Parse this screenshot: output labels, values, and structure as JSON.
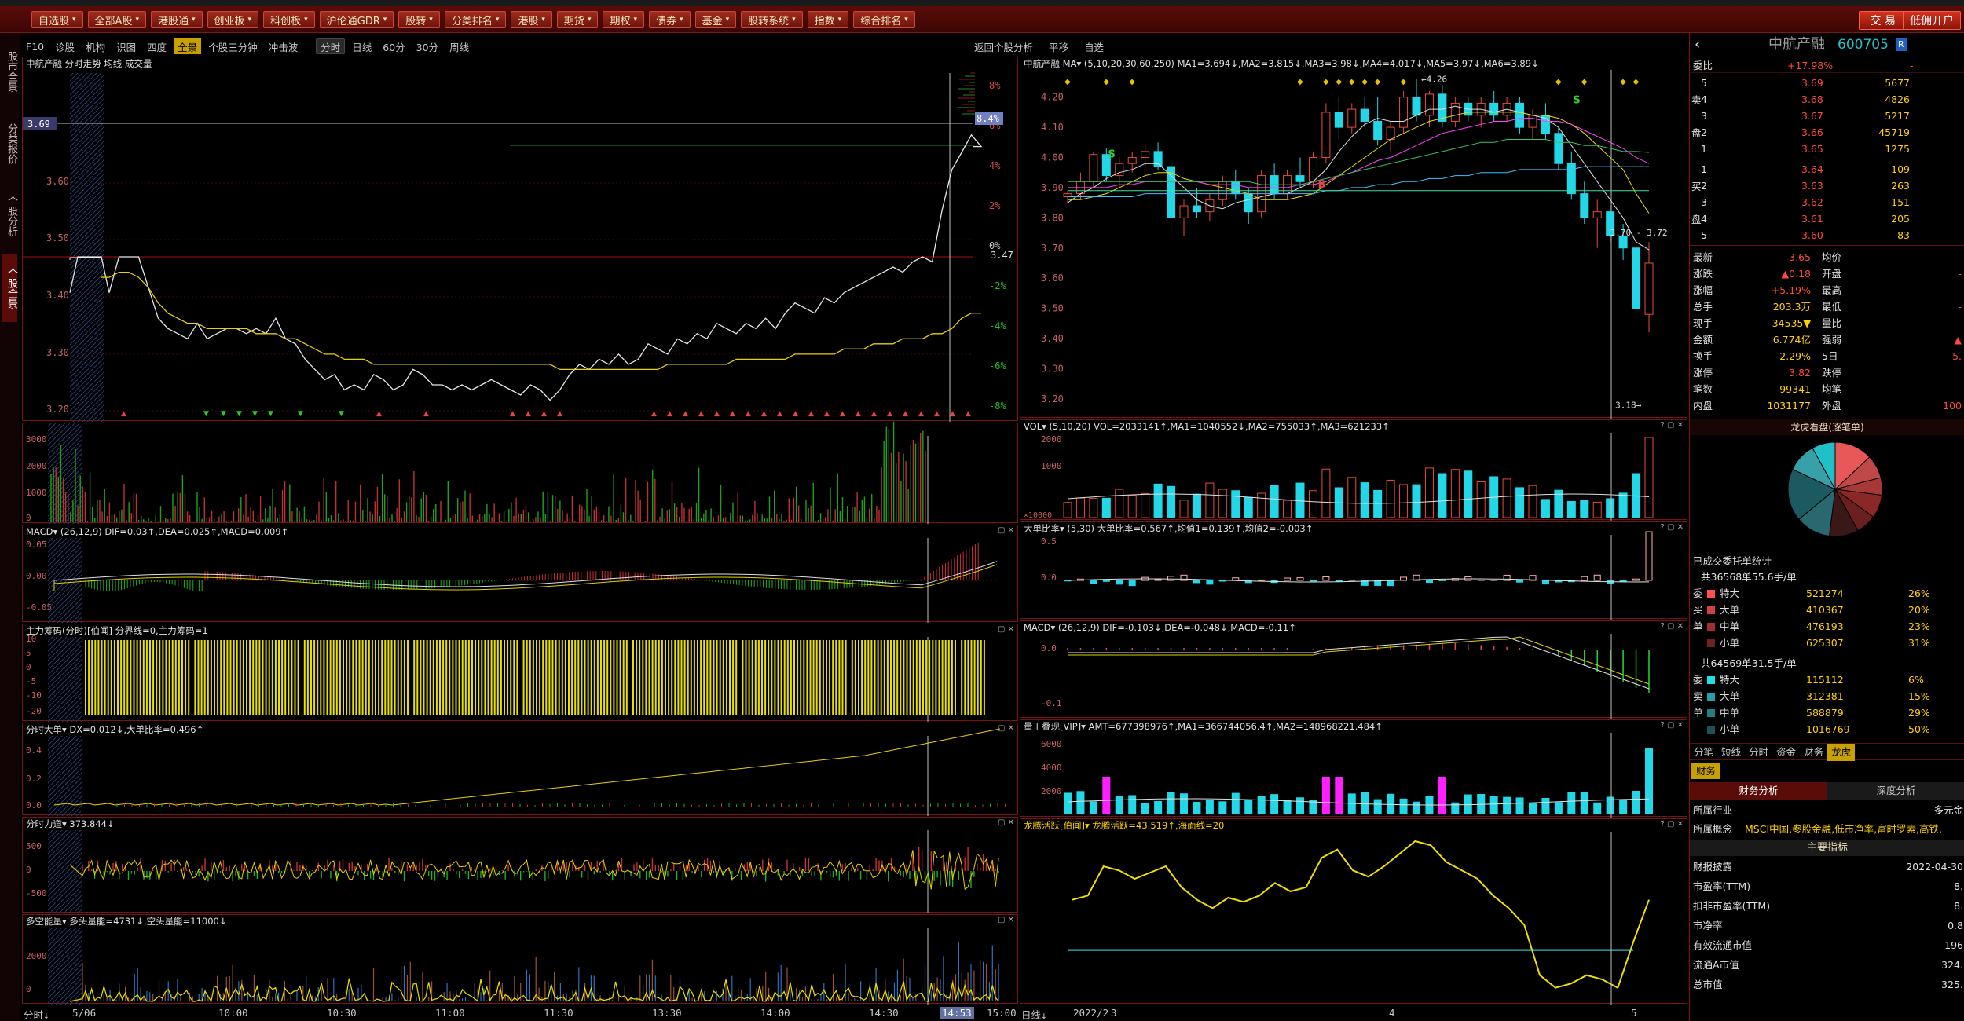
{
  "toolbar": {
    "buttons": [
      "自选股",
      "全部A股",
      "港股通",
      "创业板",
      "科创板",
      "沪伦通GDR",
      "股转",
      "分类排名",
      "港股",
      "期货",
      "期权",
      "债券",
      "基金",
      "股转系统",
      "指数",
      "综合排名"
    ],
    "trade": "交 易",
    "open_account": "低佣开户",
    "more": "期货"
  },
  "left_tabs": [
    "股市全景",
    "分类报价",
    "个股分析",
    "个股全景"
  ],
  "subtabs": {
    "items": [
      "F10",
      "诊股",
      "机构",
      "识图",
      "四度",
      "全景",
      "个股三分钟",
      "冲击波"
    ],
    "active": "全景",
    "period_items": [
      "分时",
      "日线",
      "60分",
      "30分",
      "周线"
    ],
    "right_items": [
      "返回个股分析",
      "平移",
      "自选"
    ]
  },
  "intraday": {
    "header": "中航产融  分时走势  均线  成交量",
    "hline_label": "3.69",
    "prices": [
      "3.60",
      "3.50",
      "3.40",
      "3.30",
      "3.20"
    ],
    "pcts": [
      "8%",
      "6%",
      "4%",
      "2%",
      "0%",
      "-2%",
      "-4%",
      "-6%",
      "-8%"
    ],
    "pct_badge": "8.4%",
    "mid_label": "3.47",
    "trend": [
      3.4,
      3.47,
      3.47,
      3.47,
      3.41,
      3.35,
      3.33,
      3.32,
      3.31,
      3.34,
      3.31,
      3.32,
      3.33,
      3.33,
      3.32,
      3.33,
      3.32,
      3.35,
      3.31,
      3.3,
      3.27,
      3.25,
      3.23,
      3.24,
      3.21,
      3.22,
      3.21,
      3.24,
      3.23,
      3.21,
      3.22,
      3.25,
      3.24,
      3.22,
      3.22,
      3.21,
      3.22,
      3.21,
      3.22,
      3.23,
      3.22,
      3.21,
      3.2,
      3.22,
      3.21,
      3.19,
      3.21,
      3.24,
      3.26,
      3.25,
      3.27,
      3.26,
      3.28,
      3.26,
      3.27,
      3.3,
      3.29,
      3.28,
      3.31,
      3.3,
      3.32,
      3.31,
      3.34,
      3.33,
      3.32,
      3.34,
      3.33,
      3.35,
      3.33,
      3.36,
      3.38,
      3.37,
      3.36,
      3.39,
      3.38,
      3.4,
      3.41,
      3.42,
      3.43,
      3.44,
      3.45,
      3.44,
      3.46,
      3.47,
      3.46,
      3.55,
      3.62,
      3.65,
      3.68,
      3.66
    ],
    "avg": [
      3.43,
      3.44,
      3.44,
      3.43,
      3.41,
      3.38,
      3.36,
      3.35,
      3.34,
      3.34,
      3.33,
      3.33,
      3.33,
      3.33,
      3.33,
      3.32,
      3.32,
      3.32,
      3.31,
      3.31,
      3.3,
      3.29,
      3.28,
      3.28,
      3.27,
      3.27,
      3.27,
      3.26,
      3.26,
      3.26,
      3.26,
      3.26,
      3.26,
      3.26,
      3.26,
      3.26,
      3.26,
      3.26,
      3.26,
      3.26,
      3.26,
      3.26,
      3.26,
      3.26,
      3.26,
      3.26,
      3.25,
      3.25,
      3.25,
      3.25,
      3.25,
      3.25,
      3.25,
      3.25,
      3.25,
      3.25,
      3.25,
      3.26,
      3.26,
      3.26,
      3.26,
      3.26,
      3.26,
      3.26,
      3.27,
      3.27,
      3.27,
      3.27,
      3.27,
      3.27,
      3.28,
      3.28,
      3.28,
      3.28,
      3.28,
      3.29,
      3.29,
      3.29,
      3.3,
      3.3,
      3.3,
      3.31,
      3.31,
      3.31,
      3.32,
      3.32,
      3.33,
      3.35,
      3.36,
      3.36
    ]
  },
  "vol_panel": {
    "labels": [
      "3000",
      "2000",
      "1000",
      "0"
    ]
  },
  "macd_left": {
    "header": "MACD▾  (26,12,9)  DIF=0.03↑,DEA=0.025↑,MACD=0.009↑",
    "labels": [
      "0.05",
      "0.00",
      "-0.05"
    ]
  },
  "zhuli": {
    "header": "主力筹码(分时)[伯闻]  分界线=0,主力筹码=1",
    "labels": [
      "10",
      "5",
      "0",
      "-5",
      "-10",
      "-20"
    ]
  },
  "fenshi_dadan": {
    "header": "分时大单▾  DX=0.012↓,大单比率=0.496↑",
    "labels": [
      "0.4",
      "0.2",
      "0.0"
    ]
  },
  "fenshi_lidao": {
    "header": "分时力道▾  373.844↓",
    "labels": [
      "500",
      "0",
      "-500"
    ]
  },
  "duokong": {
    "header": "多空能量▾  多头量能=4731↓,空头量能=11000↓",
    "labels": [
      "2000",
      "0"
    ]
  },
  "timeaxis": {
    "left": "分时↓",
    "date": "5/06",
    "ticks": [
      "10:00",
      "10:30",
      "11:00",
      "11:30",
      "13:30",
      "14:00",
      "14:30",
      "14:53",
      "15:00"
    ]
  },
  "daily": {
    "header": "中航产融  MA▾  (5,10,20,30,60,250)  MA1=3.694↓,MA2=3.815↓,MA3=3.98↓,MA4=4.017↓,MA5=3.97↓,MA6=3.89↓",
    "prices": [
      "4.20",
      "4.10",
      "4.00",
      "3.90",
      "3.80",
      "3.70",
      "3.60",
      "3.50",
      "3.40",
      "3.30",
      "3.20"
    ],
    "hi_label": "4.26",
    "lo_label": "3.18",
    "range_label": "3.70 - 3.72",
    "ohlc": [
      [
        3.87,
        3.89,
        3.85,
        3.88
      ],
      [
        3.88,
        3.95,
        3.86,
        3.92
      ],
      [
        3.92,
        4.02,
        3.9,
        4.01
      ],
      [
        4.01,
        4.03,
        3.92,
        3.94
      ],
      [
        3.94,
        4.0,
        3.9,
        3.98
      ],
      [
        3.98,
        4.02,
        3.95,
        4.0
      ],
      [
        4.0,
        4.04,
        3.97,
        4.02
      ],
      [
        4.02,
        4.05,
        3.96,
        3.97
      ],
      [
        3.97,
        3.99,
        3.75,
        3.8
      ],
      [
        3.8,
        3.86,
        3.74,
        3.84
      ],
      [
        3.84,
        3.9,
        3.8,
        3.82
      ],
      [
        3.82,
        3.88,
        3.79,
        3.86
      ],
      [
        3.86,
        3.94,
        3.84,
        3.92
      ],
      [
        3.92,
        3.96,
        3.86,
        3.88
      ],
      [
        3.88,
        3.9,
        3.78,
        3.82
      ],
      [
        3.82,
        3.96,
        3.8,
        3.94
      ],
      [
        3.94,
        3.98,
        3.86,
        3.88
      ],
      [
        3.88,
        3.96,
        3.86,
        3.94
      ],
      [
        3.94,
        4.0,
        3.9,
        3.92
      ],
      [
        3.92,
        4.02,
        3.9,
        4.0
      ],
      [
        4.0,
        4.18,
        3.98,
        4.15
      ],
      [
        4.15,
        4.2,
        4.06,
        4.1
      ],
      [
        4.1,
        4.18,
        4.08,
        4.16
      ],
      [
        4.16,
        4.2,
        4.1,
        4.12
      ],
      [
        4.12,
        4.2,
        4.04,
        4.06
      ],
      [
        4.06,
        4.12,
        4.02,
        4.1
      ],
      [
        4.1,
        4.22,
        4.08,
        4.2
      ],
      [
        4.2,
        4.26,
        4.12,
        4.14
      ],
      [
        4.14,
        4.22,
        4.1,
        4.21
      ],
      [
        4.21,
        4.24,
        4.1,
        4.12
      ],
      [
        4.12,
        4.2,
        4.1,
        4.18
      ],
      [
        4.18,
        4.2,
        4.12,
        4.14
      ],
      [
        4.14,
        4.2,
        4.1,
        4.18
      ],
      [
        4.18,
        4.22,
        4.12,
        4.14
      ],
      [
        4.14,
        4.2,
        4.12,
        4.18
      ],
      [
        4.18,
        4.2,
        4.08,
        4.1
      ],
      [
        4.1,
        4.16,
        4.06,
        4.14
      ],
      [
        4.14,
        4.18,
        4.06,
        4.08
      ],
      [
        4.08,
        4.1,
        3.96,
        3.98
      ],
      [
        3.98,
        4.02,
        3.86,
        3.88
      ],
      [
        3.88,
        3.92,
        3.78,
        3.8
      ],
      [
        3.8,
        3.86,
        3.7,
        3.82
      ],
      [
        3.82,
        3.84,
        3.72,
        3.74
      ],
      [
        3.74,
        3.78,
        3.66,
        3.7
      ],
      [
        3.7,
        3.72,
        3.48,
        3.5
      ],
      [
        3.48,
        3.72,
        3.42,
        3.65
      ]
    ],
    "ma_lines": [
      {
        "color": "#e0e0e0",
        "values": [
          3.85,
          3.88,
          3.9,
          3.93,
          3.95,
          3.96,
          3.98,
          3.98,
          3.94,
          3.9,
          3.86,
          3.84,
          3.83,
          3.85,
          3.86,
          3.87,
          3.88,
          3.88,
          3.9,
          3.92,
          3.96,
          4.02,
          4.07,
          4.11,
          4.13,
          4.12,
          4.12,
          4.14,
          4.16,
          4.16,
          4.17,
          4.16,
          4.16,
          4.15,
          4.16,
          4.15,
          4.14,
          4.13,
          4.1,
          4.04,
          3.98,
          3.92,
          3.86,
          3.8,
          3.72,
          3.694
        ]
      },
      {
        "color": "#e8e000",
        "values": [
          3.86,
          3.86,
          3.87,
          3.88,
          3.9,
          3.92,
          3.94,
          3.95,
          3.95,
          3.93,
          3.92,
          3.91,
          3.9,
          3.89,
          3.88,
          3.86,
          3.86,
          3.86,
          3.87,
          3.88,
          3.91,
          3.94,
          3.97,
          4.0,
          4.03,
          4.06,
          4.08,
          4.1,
          4.12,
          4.13,
          4.14,
          4.15,
          4.15,
          4.15,
          4.15,
          4.15,
          4.14,
          4.14,
          4.13,
          4.11,
          4.08,
          4.04,
          4.0,
          3.96,
          3.88,
          3.815
        ]
      },
      {
        "color": "#ff40ff",
        "values": [
          3.9,
          3.9,
          3.9,
          3.9,
          3.91,
          3.91,
          3.92,
          3.92,
          3.92,
          3.92,
          3.92,
          3.91,
          3.91,
          3.91,
          3.9,
          3.9,
          3.9,
          3.9,
          3.91,
          3.91,
          3.92,
          3.94,
          3.95,
          3.97,
          3.99,
          4.0,
          4.02,
          4.04,
          4.06,
          4.08,
          4.09,
          4.1,
          4.11,
          4.12,
          4.12,
          4.13,
          4.13,
          4.12,
          4.12,
          4.11,
          4.09,
          4.07,
          4.05,
          4.03,
          4.0,
          3.98
        ]
      },
      {
        "color": "#3cc060",
        "values": [
          3.92,
          3.92,
          3.92,
          3.92,
          3.92,
          3.92,
          3.92,
          3.92,
          3.92,
          3.92,
          3.92,
          3.92,
          3.92,
          3.92,
          3.92,
          3.91,
          3.91,
          3.91,
          3.91,
          3.92,
          3.93,
          3.94,
          3.95,
          3.96,
          3.97,
          3.98,
          3.99,
          4.0,
          4.01,
          4.02,
          4.03,
          4.04,
          4.05,
          4.05,
          4.06,
          4.06,
          4.06,
          4.06,
          4.05,
          4.05,
          4.04,
          4.04,
          4.03,
          4.02,
          4.02,
          4.017
        ]
      },
      {
        "color": "#40c0ff",
        "values": [
          3.87,
          3.87,
          3.87,
          3.87,
          3.87,
          3.87,
          3.88,
          3.88,
          3.88,
          3.88,
          3.88,
          3.88,
          3.88,
          3.88,
          3.88,
          3.88,
          3.88,
          3.88,
          3.88,
          3.88,
          3.89,
          3.89,
          3.9,
          3.9,
          3.91,
          3.91,
          3.92,
          3.92,
          3.93,
          3.93,
          3.94,
          3.94,
          3.95,
          3.95,
          3.95,
          3.96,
          3.96,
          3.96,
          3.96,
          3.96,
          3.97,
          3.97,
          3.97,
          3.97,
          3.97,
          3.97
        ]
      },
      {
        "color": "#40e0a0",
        "values": [
          3.89,
          3.89,
          3.89,
          3.89,
          3.89,
          3.89,
          3.89,
          3.89,
          3.89,
          3.89,
          3.89,
          3.89,
          3.89,
          3.89,
          3.89,
          3.89,
          3.89,
          3.89,
          3.89,
          3.89,
          3.89,
          3.89,
          3.89,
          3.89,
          3.89,
          3.89,
          3.89,
          3.89,
          3.89,
          3.89,
          3.89,
          3.89,
          3.89,
          3.89,
          3.89,
          3.89,
          3.89,
          3.89,
          3.89,
          3.89,
          3.89,
          3.89,
          3.89,
          3.89,
          3.89,
          3.89
        ]
      }
    ]
  },
  "vol_daily": {
    "header": "VOL▾  (5,10,20)  VOL=2033141↑,MA1=1040552↓,MA2=755033↑,MA3=621233↑",
    "labels": [
      "2000",
      "1000"
    ],
    "unit": "×10000"
  },
  "dadan_ratio": {
    "header": "大单比率▾  (5,30)  大单比率=0.567↑,均值1=0.139↑,均值2=-0.003↑",
    "labels": [
      "0.5",
      "0.0"
    ]
  },
  "macd_daily": {
    "header": "MACD▾  (26,12,9)  DIF=-0.103↓,DEA=-0.048↓,MACD=-0.11↑",
    "labels": [
      "0.0",
      "-0.1"
    ]
  },
  "liangwang": {
    "header": "量王叠现[VIP]▾  AMT=677398976↑,MA1=366744056.4↑,MA2=148968221.484↑",
    "labels": [
      "6000",
      "4000",
      "2000"
    ]
  },
  "longhu": {
    "header": "龙腾活跃[伯闻]▾  龙腾活跃=43.519↑,海面线=20",
    "values": [
      44,
      46,
      60,
      58,
      54,
      57,
      60,
      50,
      44,
      40,
      45,
      43,
      46,
      52,
      48,
      50,
      64,
      68,
      58,
      55,
      60,
      66,
      72,
      70,
      62,
      58,
      54,
      46,
      40,
      32,
      8,
      2,
      4,
      8,
      6,
      2,
      24,
      44
    ],
    "line": 20
  },
  "daily_axis": {
    "left": "日线↓",
    "ticks": [
      "2022/2",
      "3",
      "4",
      "5"
    ]
  },
  "sidebar": {
    "name": "中航产融",
    "code": "600705",
    "badge": "R",
    "weibi_label": "委比",
    "weibi": "+17.98%",
    "weicha": "-",
    "asks": [
      {
        "l": "5",
        "p": "3.69",
        "v": "5677"
      },
      {
        "l": "4",
        "p": "3.68",
        "v": "4826"
      },
      {
        "l": "3",
        "p": "3.67",
        "v": "5217"
      },
      {
        "l": "2",
        "p": "3.66",
        "v": "45719"
      },
      {
        "l": "1",
        "p": "3.65",
        "v": "1275"
      }
    ],
    "bids": [
      {
        "l": "1",
        "p": "3.64",
        "v": "109"
      },
      {
        "l": "2",
        "p": "3.63",
        "v": "263"
      },
      {
        "l": "3",
        "p": "3.62",
        "v": "151"
      },
      {
        "l": "4",
        "p": "3.61",
        "v": "205"
      },
      {
        "l": "5",
        "p": "3.60",
        "v": "83"
      }
    ],
    "sell_label": "卖",
    "buy_label": "买",
    "pan_label": "盘",
    "stats": [
      [
        "最新",
        "3.65",
        "均价",
        "-"
      ],
      [
        "涨跌",
        "▲0.18",
        "开盘",
        "-"
      ],
      [
        "涨幅",
        "+5.19%",
        "最高",
        "-"
      ],
      [
        "总手",
        "203.3万",
        "最低",
        "-"
      ],
      [
        "现手",
        "34535▼",
        "量比",
        "-"
      ],
      [
        "金额",
        "6.774亿",
        "强弱",
        "▲"
      ],
      [
        "换手",
        "2.29%",
        "5日",
        "5."
      ],
      [
        "涨停",
        "3.82",
        "跌停",
        ""
      ],
      [
        "笔数",
        "99341",
        "均笔",
        ""
      ],
      [
        "内盘",
        "1031177",
        "外盘",
        "100"
      ]
    ],
    "pie_title": "龙虎看盘(逐笔单)",
    "pie": [
      {
        "v": 13,
        "c": "#e85858"
      },
      {
        "v": 8,
        "c": "#c04848"
      },
      {
        "v": 6,
        "c": "#a83838"
      },
      {
        "v": 8,
        "c": "#8a2828"
      },
      {
        "v": 7,
        "c": "#6a2020"
      },
      {
        "v": 10,
        "c": "#3a1818"
      },
      {
        "v": 12,
        "c": "#2a6870"
      },
      {
        "v": 18,
        "c": "#1a5a60"
      },
      {
        "v": 10,
        "c": "#38a0a8"
      },
      {
        "v": 8,
        "c": "#20c0c8"
      }
    ],
    "done_title": "已成交委托单统计",
    "buy_total": "共36568单55.6手/单",
    "buy_rows": [
      [
        "特大",
        "521274",
        "26%"
      ],
      [
        "大单",
        "410367",
        "20%"
      ],
      [
        "中单",
        "476193",
        "23%"
      ],
      [
        "小单",
        "625307",
        "31%"
      ]
    ],
    "sell_total": "共64569单31.5手/单",
    "sell_rows": [
      [
        "特大",
        "115112",
        "6%"
      ],
      [
        "大单",
        "312381",
        "15%"
      ],
      [
        "中单",
        "588879",
        "29%"
      ],
      [
        "小单",
        "1016769",
        "50%"
      ]
    ],
    "buy_side": [
      "委",
      "买",
      "单"
    ],
    "sell_side": [
      "委",
      "卖",
      "单"
    ],
    "bottom_tabs": [
      "分笔",
      "短线",
      "分时",
      "资金",
      "财务",
      "龙虎"
    ],
    "active_bottom": "龙虎",
    "fin_tab": "财务",
    "fin_sections": [
      "财务分析",
      "深度分析"
    ],
    "industry_label": "所属行业",
    "industry": "多元金",
    "concept_label": "所属概念",
    "concept": "MSCI中国,参股金融,低市净率,富时罗素,高铁,",
    "main_index": "主要指标",
    "fin_rows": [
      [
        "财报披露",
        "2022-04-30"
      ],
      [
        "市盈率(TTM)",
        "8."
      ],
      [
        "扣非市盈率(TTM)",
        "8."
      ],
      [
        "市净率",
        "0.8"
      ],
      [
        "有效流通市值",
        "196"
      ],
      [
        "流通A市值",
        "324."
      ],
      [
        "总市值",
        "325."
      ]
    ]
  }
}
